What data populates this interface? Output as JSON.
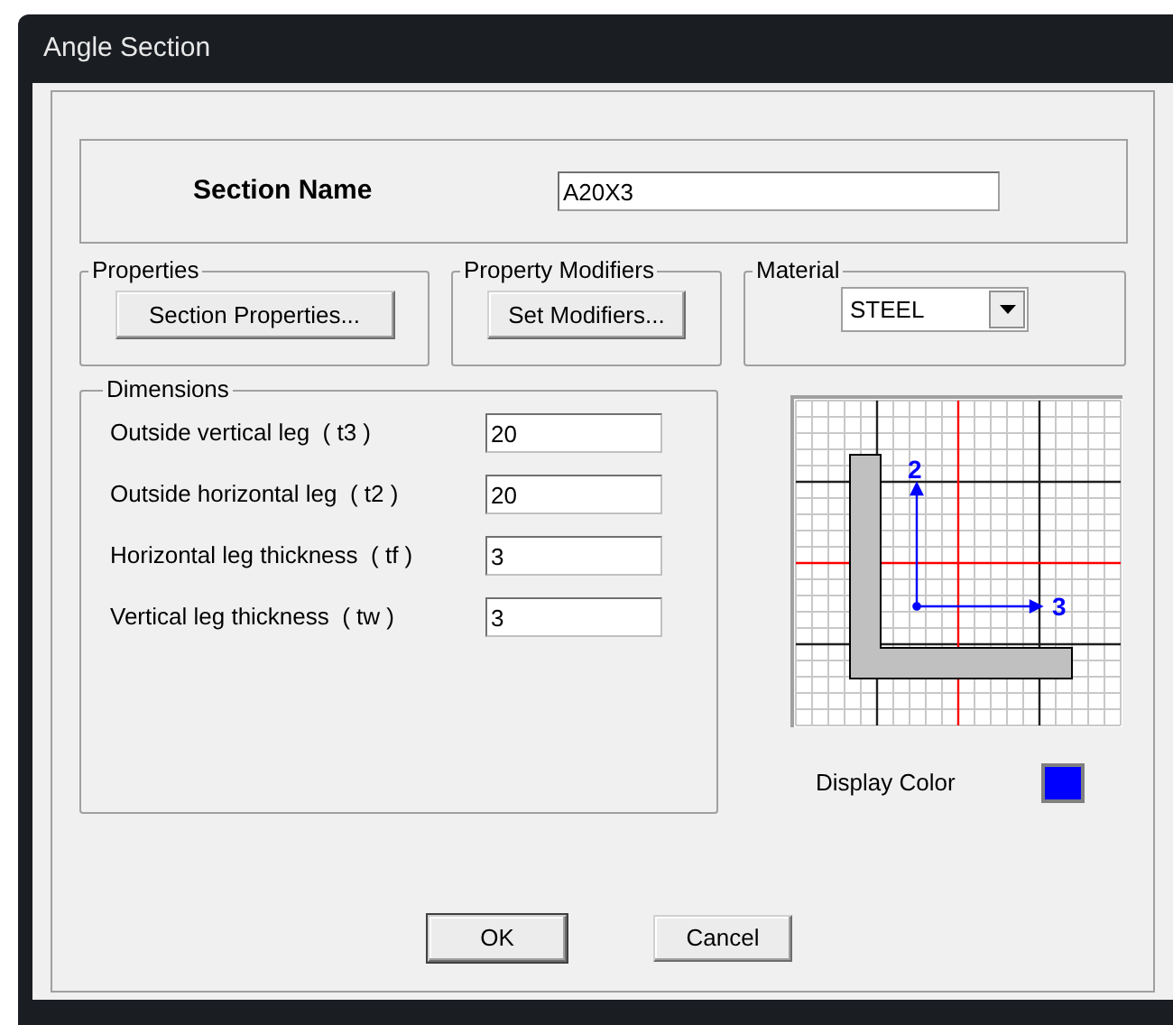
{
  "window": {
    "title": "Angle Section"
  },
  "section_name": {
    "label": "Section Name",
    "value": "A20X3"
  },
  "properties": {
    "title": "Properties",
    "button": "Section Properties..."
  },
  "property_modifiers": {
    "title": "Property Modifiers",
    "button": "Set Modifiers..."
  },
  "material": {
    "title": "Material",
    "value": "STEEL"
  },
  "dimensions": {
    "title": "Dimensions",
    "fields": [
      {
        "label": "Outside vertical leg  ( t3 )",
        "value": "20"
      },
      {
        "label": "Outside horizontal leg  ( t2 )",
        "value": "20"
      },
      {
        "label": "Horizontal leg thickness  ( tf )",
        "value": "3"
      },
      {
        "label": "Vertical leg thickness  ( tw )",
        "value": "3"
      }
    ]
  },
  "diagram": {
    "axis_labels": [
      "2",
      "3"
    ]
  },
  "display_color": {
    "label": "Display Color",
    "color": "#0000ff"
  },
  "buttons": [
    "OK",
    "Cancel"
  ]
}
